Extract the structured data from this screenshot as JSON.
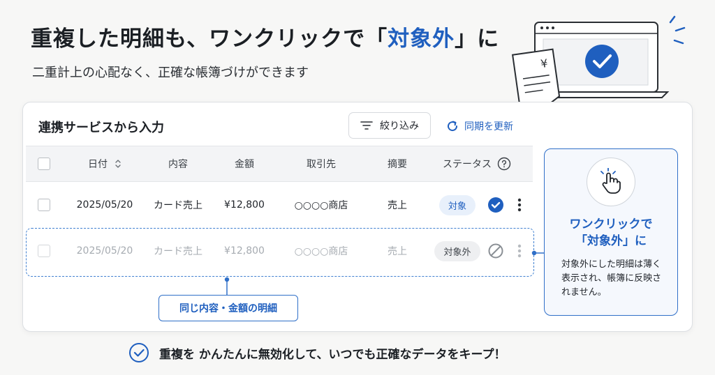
{
  "hero": {
    "title_before": "重複した明細も、ワンクリックで「",
    "title_accent": "対象外",
    "title_after": "」に",
    "subtitle": "二重計上の心配なく、正確な帳簿づけができます"
  },
  "illustration": {
    "currency_symbol": "¥"
  },
  "card": {
    "title": "連携サービスから入力",
    "filter_label": "絞り込み",
    "refresh_label": "同期を更新"
  },
  "table": {
    "headers": {
      "date": "日付",
      "desc": "内容",
      "amount": "金額",
      "partner": "取引先",
      "memo": "摘要",
      "status": "ステータス"
    },
    "rows": [
      {
        "date": "2025/05/20",
        "desc": "カード売上",
        "amount": "¥12,800",
        "partner": "○○○○商店",
        "memo": "売上",
        "status": "対象"
      },
      {
        "date": "2025/05/20",
        "desc": "カード売上",
        "amount": "¥12,800",
        "partner": "○○○○商店",
        "memo": "売上",
        "status": "対象外"
      }
    ]
  },
  "duplicate_label": "同じ内容・金額の明細",
  "side_panel": {
    "title_line1": "ワンクリックで",
    "title_line2": "「対象外」に",
    "description": "対象外にした明細は薄く表示され、帳簿に反映されません。"
  },
  "footer": {
    "text": "重複を かんたんに無効化して、いつでも正確なデータをキープ！"
  },
  "colors": {
    "accent": "#1f5fbf",
    "text": "#1b1f24",
    "muted": "#a6abb1"
  },
  "icons": [
    "filter-icon",
    "refresh-icon",
    "sort-icon",
    "help-icon",
    "check-circle-icon",
    "block-icon",
    "more-icon",
    "hand-pointer-icon",
    "check-outline-icon"
  ]
}
